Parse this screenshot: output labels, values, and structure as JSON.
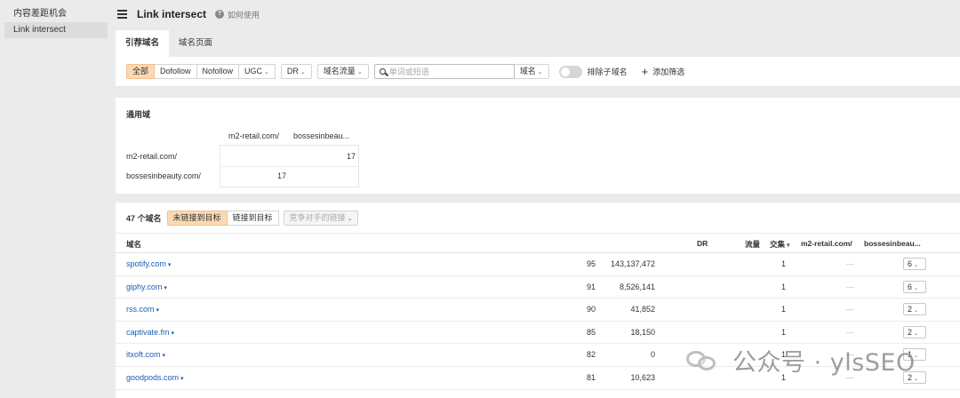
{
  "sidebar": {
    "items": [
      {
        "label": "内容差距机会"
      },
      {
        "label": "Link intersect"
      }
    ]
  },
  "header": {
    "title": "Link intersect",
    "help_label": "如何使用"
  },
  "tabs": [
    {
      "label": "引荐域名"
    },
    {
      "label": "域名页面"
    }
  ],
  "filters": {
    "link_types": [
      "全部",
      "Dofollow",
      "Nofollow"
    ],
    "ugc_label": "UGC",
    "dr_label": "DR",
    "traffic_label": "域名流量",
    "search_placeholder": "单词或短语",
    "search_scope": "域名",
    "exclude_subdomains_label": "排除子域名",
    "add_filter_label": "添加筛选"
  },
  "common_domains": {
    "title": "通用域",
    "columns": [
      "m2-retail.com/",
      "bossesinbeau..."
    ],
    "rows": [
      {
        "label": "m2-retail.com/",
        "values": [
          "",
          "17"
        ]
      },
      {
        "label": "bossesinbeauty.com/",
        "values": [
          "17",
          ""
        ]
      }
    ]
  },
  "results": {
    "count_label": "47 个域名",
    "segments": [
      "未链接到目标",
      "链接到目标"
    ],
    "competitor_label": "竞争对手的链接",
    "columns": {
      "domain": "域名",
      "dr": "DR",
      "traffic": "流量",
      "intersect": "交集",
      "m2": "m2-retail.com/",
      "bosses": "bossesinbeau..."
    },
    "rows": [
      {
        "domain": "spotify.com",
        "dr": "95",
        "traffic": "143,137,472",
        "intersect": "1",
        "m2": "—",
        "bosses": "6"
      },
      {
        "domain": "giphy.com",
        "dr": "91",
        "traffic": "8,526,141",
        "intersect": "1",
        "m2": "—",
        "bosses": "6"
      },
      {
        "domain": "rss.com",
        "dr": "90",
        "traffic": "41,852",
        "intersect": "1",
        "m2": "—",
        "bosses": "2"
      },
      {
        "domain": "captivate.fm",
        "dr": "85",
        "traffic": "18,150",
        "intersect": "1",
        "m2": "—",
        "bosses": "2"
      },
      {
        "domain": "itxoft.com",
        "dr": "82",
        "traffic": "0",
        "intersect": "1",
        "m2": "—",
        "bosses": "1"
      },
      {
        "domain": "goodpods.com",
        "dr": "81",
        "traffic": "10,623",
        "intersect": "1",
        "m2": "—",
        "bosses": "2"
      }
    ]
  },
  "watermark": {
    "text": "公众号 · ylsSEO"
  }
}
